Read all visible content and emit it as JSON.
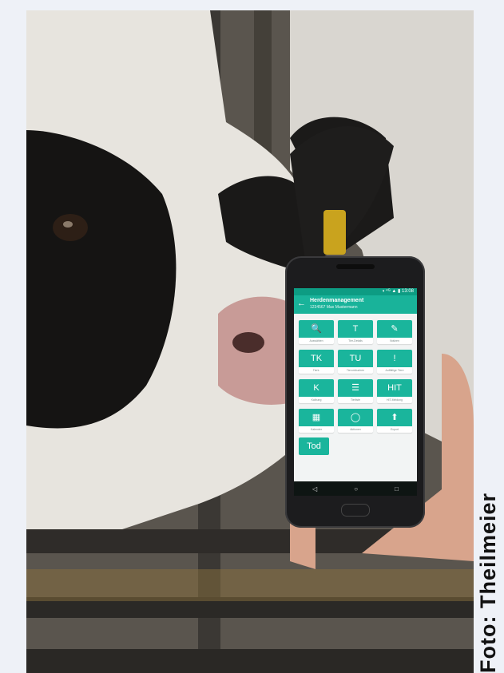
{
  "credit": "Foto: Theilmeier",
  "phone": {
    "status_text": "◑ ⁴ᴳ ▲ ▮ 13:08",
    "appbar": {
      "back_icon": "arrow-left-icon",
      "title": "Herdenmanagement",
      "subtitle": "1234567 Max Mustermann"
    },
    "tiles": [
      {
        "glyph": "🔍",
        "icon": "search-icon",
        "caption": "Auswählen"
      },
      {
        "glyph": "T",
        "icon": "",
        "caption": "Tier-Details"
      },
      {
        "glyph": "✎",
        "icon": "pen-icon",
        "caption": "Notizen"
      },
      {
        "glyph": "TK",
        "icon": "",
        "caption": "Tierk."
      },
      {
        "glyph": "TU",
        "icon": "",
        "caption": "Tierumbuchen"
      },
      {
        "glyph": "!",
        "icon": "alert-icon",
        "caption": "Auffällige Tiere"
      },
      {
        "glyph": "K",
        "icon": "",
        "caption": "Kalbung"
      },
      {
        "glyph": "☰",
        "icon": "list-icon",
        "caption": "Tierliste"
      },
      {
        "glyph": "HIT",
        "icon": "",
        "caption": "HIT-Meldung"
      },
      {
        "glyph": "▦",
        "icon": "calendar-icon",
        "caption": "Kalender"
      },
      {
        "glyph": "◯",
        "icon": "circle-icon",
        "caption": "Aktionen"
      },
      {
        "glyph": "⬆",
        "icon": "upload-icon",
        "caption": "Export"
      }
    ],
    "tod_label": "Tod",
    "nav": {
      "back": "◁",
      "home": "○",
      "recent": "□"
    }
  }
}
